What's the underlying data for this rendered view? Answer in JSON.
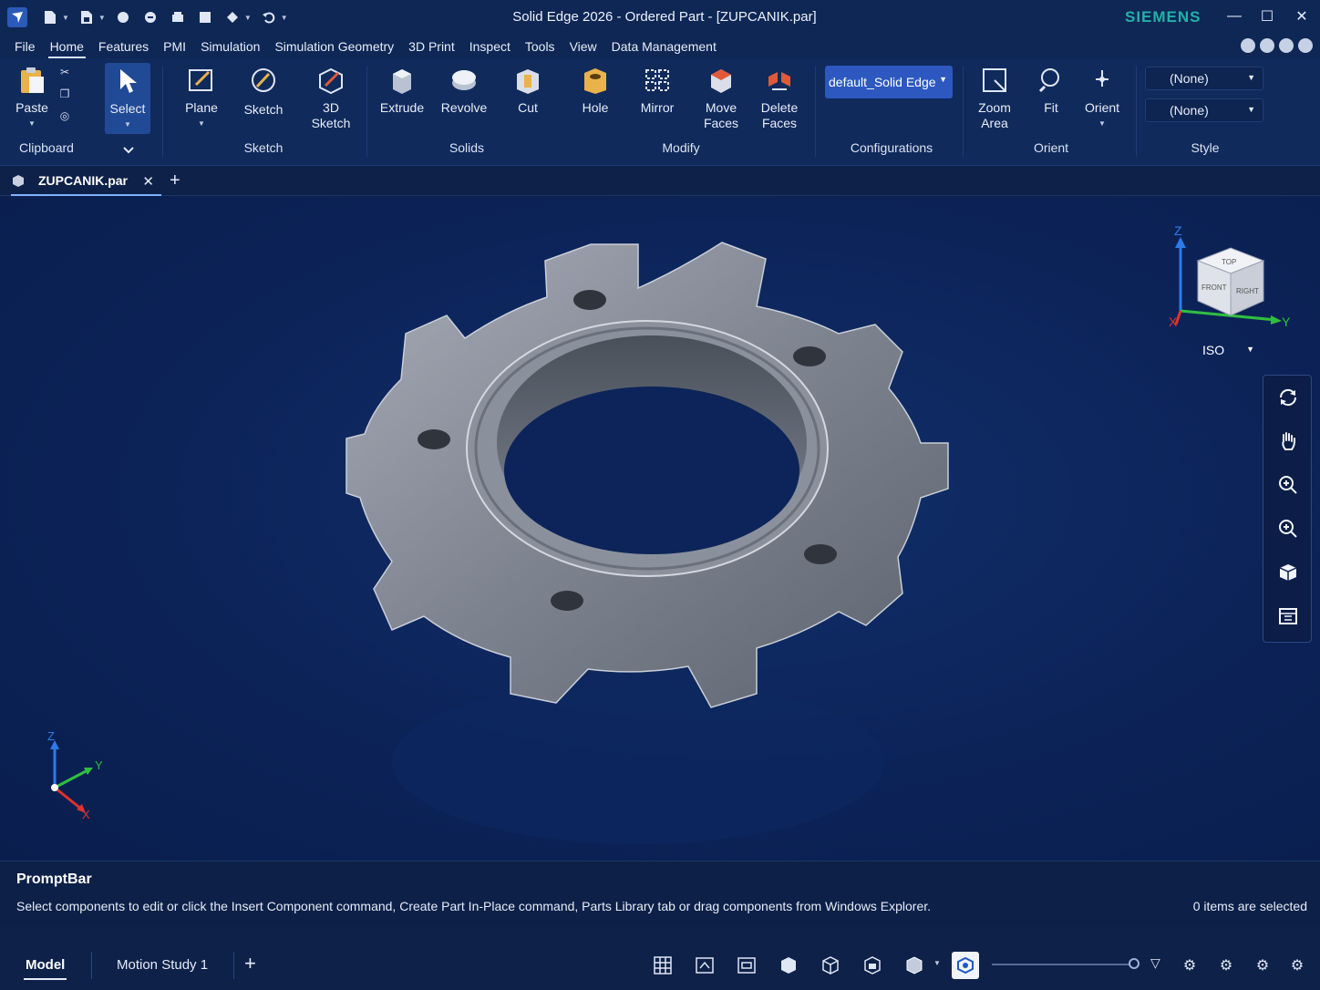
{
  "window": {
    "title": "Solid Edge 2026 - Ordered Part - [ZUPCANIK.par]",
    "brand": "SIEMENS"
  },
  "menu": {
    "items": [
      "File",
      "Home",
      "Features",
      "PMI",
      "Simulation",
      "Simulation Geometry",
      "3D Print",
      "Inspect",
      "Tools",
      "View",
      "Data Management"
    ],
    "active": "Home"
  },
  "ribbon": {
    "paste": "Paste",
    "select": "Select",
    "plane": "Plane",
    "sketch": "Sketch",
    "sketch3d_l1": "3D",
    "sketch3d_l2": "Sketch",
    "extrude": "Extrude",
    "revolve": "Revolve",
    "cut": "Cut",
    "hole": "Hole",
    "mirror": "Mirror",
    "move_l1": "Move",
    "move_l2": "Faces",
    "delete_l1": "Delete",
    "delete_l2": "Faces",
    "config_value": "default_Solid Edge",
    "zoom_l1": "Zoom",
    "zoom_l2": "Area",
    "fit": "Fit",
    "orient": "Orient",
    "style1": "(None)",
    "style2": "(None)",
    "groups": {
      "clipboard": "Clipboard",
      "sketch": "Sketch",
      "solids": "Solids",
      "modify": "Modify",
      "configurations": "Configurations",
      "orient": "Orient",
      "style": "Style"
    }
  },
  "document": {
    "tab": "ZUPCANIK.par"
  },
  "viewcube": {
    "view": "ISO",
    "faces": {
      "top": "TOP",
      "front": "FRONT",
      "right": "RIGHT"
    },
    "axes": {
      "x": "X",
      "y": "Y",
      "z": "Z"
    }
  },
  "triad": {
    "x": "X",
    "y": "Y",
    "z": "Z"
  },
  "prompt": {
    "title": "PromptBar",
    "message": "Select components to edit or click the Insert Component command, Create Part In-Place command, Parts Library tab or drag components from Windows Explorer.",
    "selection": "0 items are selected"
  },
  "status": {
    "tabs": [
      "Model",
      "Motion Study 1"
    ],
    "active": "Model"
  },
  "colors": {
    "background": "#0e2149",
    "ribbon": "#102a5c",
    "accent": "#2c58c0",
    "brand": "#22b1a8"
  }
}
